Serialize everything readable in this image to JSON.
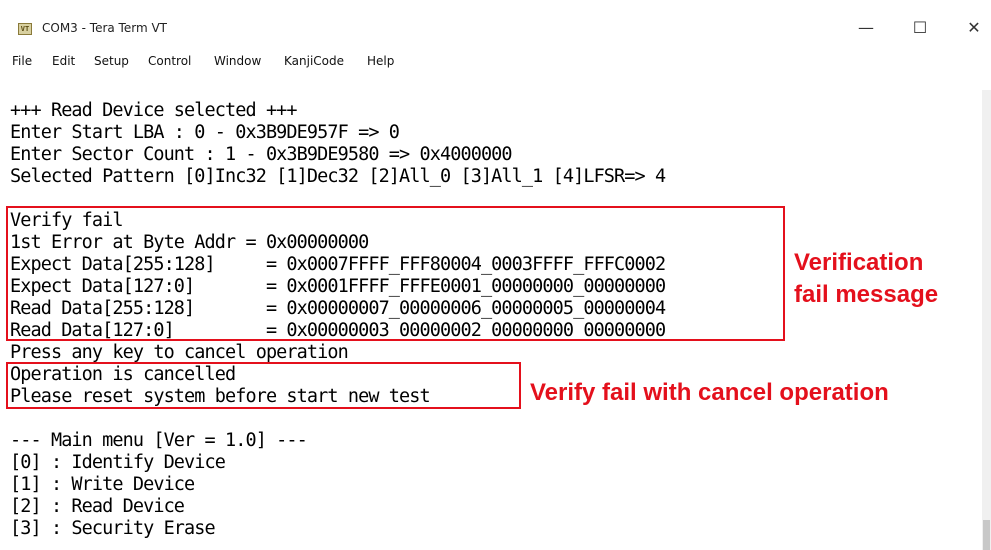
{
  "window": {
    "icon_text": "VT",
    "title": "COM3 - Tera Term VT",
    "minimize": "—",
    "maximize": "☐",
    "close": "✕"
  },
  "menu": [
    {
      "label": "File"
    },
    {
      "label": "Edit"
    },
    {
      "label": "Setup"
    },
    {
      "label": "Control"
    },
    {
      "label": "Window"
    },
    {
      "label": "KanjiCode"
    },
    {
      "label": "Help"
    }
  ],
  "terminal": {
    "lines": [
      "+++ Read Device selected +++",
      "Enter Start LBA : 0 - 0x3B9DE957F => 0",
      "Enter Sector Count : 1 - 0x3B9DE9580 => 0x4000000",
      "Selected Pattern [0]Inc32 [1]Dec32 [2]All_0 [3]All_1 [4]LFSR=> 4",
      "",
      "Verify fail",
      "1st Error at Byte Addr = 0x00000000",
      "Expect Data[255:128]     = 0x0007FFFF_FFF80004_0003FFFF_FFFC0002",
      "Expect Data[127:0]       = 0x0001FFFF_FFFE0001_00000000_00000000",
      "Read Data[255:128]       = 0x00000007_00000006_00000005_00000004",
      "Read Data[127:0]         = 0x00000003_00000002_00000000_00000000",
      "Press any key to cancel operation",
      "Operation is cancelled",
      "Please reset system before start new test",
      "",
      "--- Main menu [Ver = 1.0] ---",
      "[0] : Identify Device",
      "[1] : Write Device",
      "[2] : Read Device",
      "[3] : Security Erase"
    ]
  },
  "annotations": {
    "verification": [
      "Verification",
      "fail message"
    ],
    "cancel": "Verify fail with cancel operation",
    "color": "#e4101c"
  }
}
